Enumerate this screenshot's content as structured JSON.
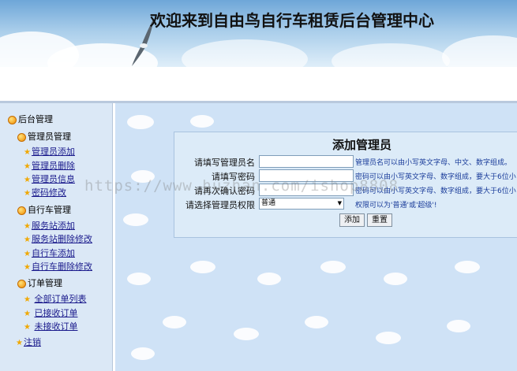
{
  "banner": {
    "title": "欢迎来到自由鸟自行车租赁后台管理中心"
  },
  "sidebar": {
    "root_label": "后台管理",
    "sections": [
      {
        "title": "管理员管理",
        "items": [
          "管理员添加",
          "管理员删除",
          "管理员信息",
          "密码修改"
        ]
      },
      {
        "title": "自行车管理",
        "items": [
          "服务站添加",
          "服务站删除修改",
          "自行车添加",
          "自行车删除修改"
        ]
      },
      {
        "title": "订单管理",
        "items": [
          "全部订单列表",
          "已接收订单",
          "未接收订单"
        ]
      }
    ],
    "logout_label": "注销"
  },
  "form": {
    "title": "添加管理员",
    "username_label": "请填写管理员名",
    "username_hint": "管理员名可以由小写英文字母、中文、数字组成。",
    "password_label": "请填写密码",
    "password_hint": "密码可以由小写英文字母、数字组成，要大于6位小",
    "confirm_label": "请再次确认密码",
    "confirm_hint": "密码可以由小写英文字母、数字组成，要大于6位小",
    "role_label": "请选择管理员权限",
    "role_selected": "普通",
    "role_hint": "权限可以为'普通'或'超级'!",
    "add_button": "添加",
    "reset_button": "重置"
  },
  "watermark": "https://www.huzhan.com/ishop8808"
}
